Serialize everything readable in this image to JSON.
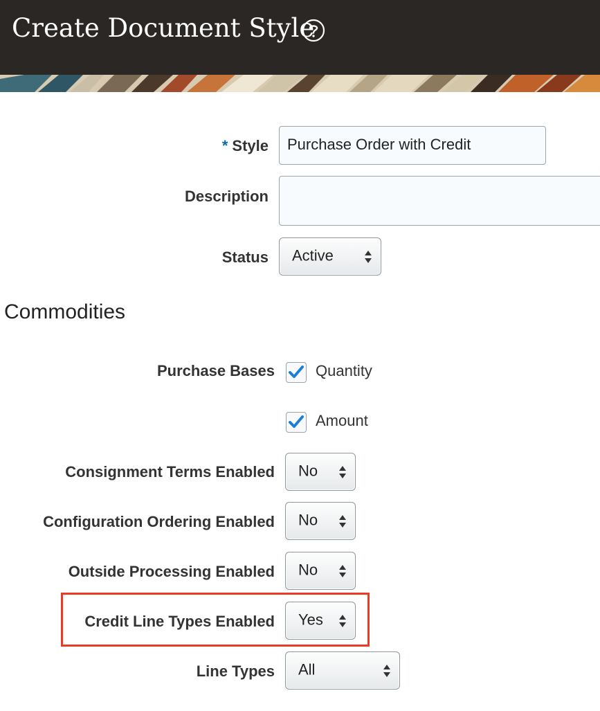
{
  "header": {
    "title": "Create Document Style",
    "help_icon": "help-circle-icon",
    "background_color": "#2b2724"
  },
  "form": {
    "style": {
      "label": "Style",
      "required_marker": "*",
      "value": "Purchase Order with Credit"
    },
    "description": {
      "label": "Description",
      "value": ""
    },
    "status": {
      "label": "Status",
      "value": "Active"
    }
  },
  "commodities": {
    "title": "Commodities",
    "purchase_bases": {
      "label": "Purchase Bases",
      "options": [
        {
          "label": "Quantity",
          "checked": true
        },
        {
          "label": "Amount",
          "checked": true
        }
      ]
    },
    "consignment_terms": {
      "label": "Consignment Terms Enabled",
      "value": "No"
    },
    "configuration_ordering": {
      "label": "Configuration Ordering Enabled",
      "value": "No"
    },
    "outside_processing": {
      "label": "Outside Processing Enabled",
      "value": "No"
    },
    "credit_line_types": {
      "label": "Credit Line Types Enabled",
      "value": "Yes"
    },
    "line_types": {
      "label": "Line Types",
      "value": "All"
    }
  },
  "colors": {
    "accent_required": "#0a6aad",
    "checkmark": "#1a7fd4",
    "highlight": "#e83a25"
  }
}
